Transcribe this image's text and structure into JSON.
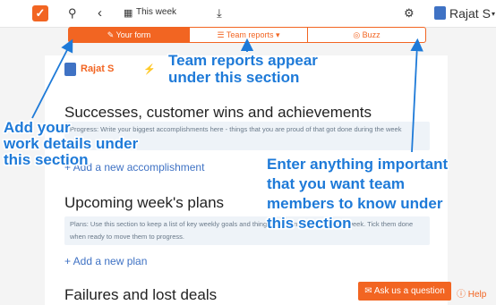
{
  "topbar": {
    "week_label": "This week",
    "user_name": "Rajat S",
    "icons": [
      "logo-icon",
      "search-icon",
      "chevron-left-icon",
      "calendar-icon",
      "download-icon",
      "gear-icon",
      "caret-down-icon"
    ]
  },
  "tabs": [
    {
      "label": "✎ Your form",
      "active": true
    },
    {
      "label": "☰ Team reports ▾",
      "active": false
    },
    {
      "label": "◎ Buzz",
      "active": false
    }
  ],
  "card": {
    "person_name": "Rajat S",
    "sections": [
      {
        "title": "Successes, customer wins and achievements",
        "hint": "Progress: Write your biggest accomplishments here - things that you are proud of that got done during the week ending.",
        "add_label": "+ Add a new accomplishment"
      },
      {
        "title": "Upcoming week's plans",
        "hint": "Plans: Use this section to keep a list of key weekly goals and things you plan to do during the week. Tick them done when ready to move them to progress.",
        "add_label": "+ Add a new plan"
      },
      {
        "title": "Failures and lost deals"
      }
    ]
  },
  "footer": {
    "ask_label": "✉ Ask us a question",
    "help_label": "ⓘ Help"
  },
  "annotations": {
    "team_reports": [
      "Team reports appear",
      "under this section"
    ],
    "your_form": [
      "Add your",
      "work details under",
      "this section"
    ],
    "buzz": [
      "Enter anything important",
      "that you want team",
      "members to know under",
      "this section"
    ]
  },
  "colors": {
    "accent": "#f26522",
    "annotation": "#1e7ad8",
    "link": "#3f72c4"
  }
}
